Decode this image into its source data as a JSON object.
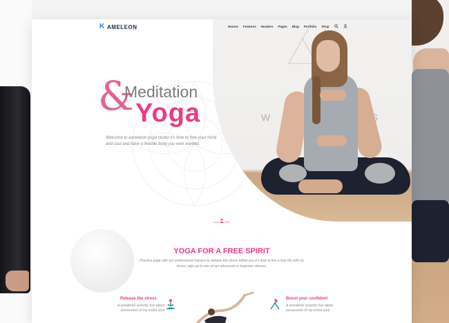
{
  "brand": {
    "logo_text": "AMELEON",
    "logo_mark": "K"
  },
  "nav": {
    "items": [
      "Homes",
      "Features",
      "Headers",
      "Pages",
      "Blog",
      "Portfolio",
      "Shop"
    ],
    "icons": [
      "search-icon",
      "user-icon"
    ]
  },
  "hero": {
    "line1": "Meditation",
    "ampersand": "&",
    "line2": "Yoga",
    "description": "Welcome to kameleon yoga studio it's time to free your mind and soul and have a flexible body you ever wanted.",
    "wall_text_left": "W",
    "wall_text_right": "S S"
  },
  "section": {
    "title": "YOGA FOR A FREE SPIRIT",
    "description": "Practice yoga with our professional trainers to release the stress within you it's time to live a free life with no stress, sign up to one of our advanced or beginner classes."
  },
  "features": [
    {
      "title": "Release the stress",
      "text": "A wonderful serenity has taken possession of my entire soul",
      "icon": "meditation-icon"
    },
    {
      "title": "Boost your confident",
      "text": "A wonderful serenity has taken possession of my entire soul",
      "icon": "yoga-pose-icon"
    }
  ],
  "colors": {
    "accent": "#ec3a86",
    "logo": "#2e7fd6",
    "text": "#8a8a8a"
  }
}
